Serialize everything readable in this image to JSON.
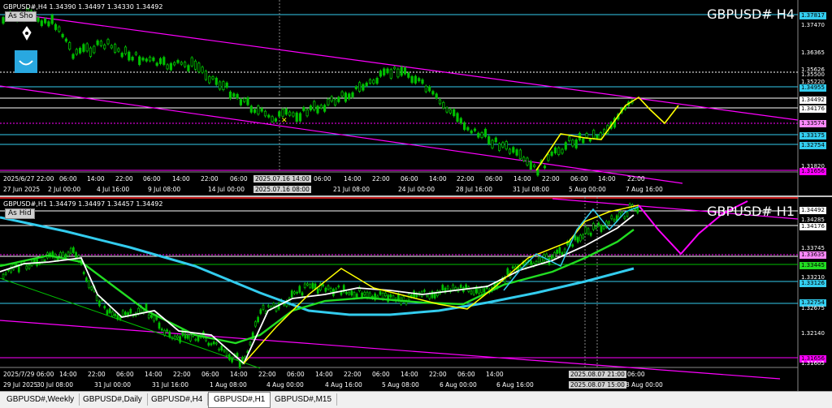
{
  "panes": {
    "h4": {
      "symbol_header": "GBPUSD#,H4  1.34390 1.34497 1.34330 1.34492",
      "badge": "As Sho",
      "title": "GBPUSD#  H4",
      "price_labels": [
        "1.37817",
        "1.37470",
        "1.36365",
        "1.35626",
        "1.35500",
        "1.35220",
        "1.34955",
        "1.34492",
        "1.34176",
        "1.33574",
        "1.33175",
        "1.32754",
        "1.31820",
        "1.31656"
      ],
      "time_labels": [
        "2025/6/27 22:00",
        "06:00",
        "14:00",
        "22:00",
        "06:00",
        "14:00",
        "22:00",
        "06:00",
        "2025.07.16 14:00",
        "06:00",
        "14:00",
        "22:00",
        "06:00",
        "14:00",
        "22:00",
        "06:00",
        "14:00",
        "22:00",
        "06:00",
        "14:00",
        "22:00"
      ],
      "date_labels": [
        "27 Jun 2025",
        "2 Jul 00:00",
        "4 Jul 16:00",
        "9 Jul 08:00",
        "14 Jul 00:00",
        "2025.07.16 08:00",
        "21 Jul 08:00",
        "24 Jul 00:00",
        "28 Jul 16:00",
        "31 Jul 08:00",
        "5 Aug 00:00",
        "7 Aug 16:00"
      ]
    },
    "h1": {
      "symbol_header": "GBPUSD#,H1  1.34479 1.34497 1.34457 1.34492",
      "badge": "As Hid",
      "title": "GBPUSD#  H1",
      "price_labels": [
        "1.34492",
        "1.34285",
        "1.34176",
        "1.33745",
        "1.33635",
        "1.33445",
        "1.33210",
        "1.33126",
        "1.32754",
        "1.32675",
        "1.32140",
        "1.31656",
        "1.31605"
      ],
      "time_labels": [
        "2025/7/29 06:00",
        "14:00",
        "22:00",
        "06:00",
        "14:00",
        "22:00",
        "06:00",
        "14:00",
        "22:00",
        "06:00",
        "14:00",
        "22:00",
        "06:00",
        "14:00",
        "22:00",
        "06:00",
        "14:00",
        "2025.08.07 21:00",
        "06:00"
      ],
      "date_labels": [
        "29 Jul 2025",
        "30 Jul 08:00",
        "31 Jul 00:00",
        "31 Jul 16:00",
        "1 Aug 08:00",
        "4 Aug 00:00",
        "4 Aug 16:00",
        "5 Aug 08:00",
        "6 Aug 00:00",
        "6 Aug 16:00",
        "2025.08.07 15:00",
        "8 Aug 00:00"
      ]
    }
  },
  "tabs": [
    "GBPUSD#,Weekly",
    "GBPUSD#,Daily",
    "GBPUSD#,H4",
    "GBPUSD#,H1",
    "GBPUSD#,M15"
  ],
  "active_tab": "GBPUSD#,H1",
  "colors": {
    "background": "#000000",
    "candles": "#00c000",
    "channel": "#ff00ff",
    "forecast": "#ffff00",
    "ma_fast": "#ffffff",
    "ma_mid": "#22dd22",
    "ma_slow": "#33ccee"
  },
  "icons": [
    "pen-tool-icon",
    "smile-indicator-icon"
  ]
}
